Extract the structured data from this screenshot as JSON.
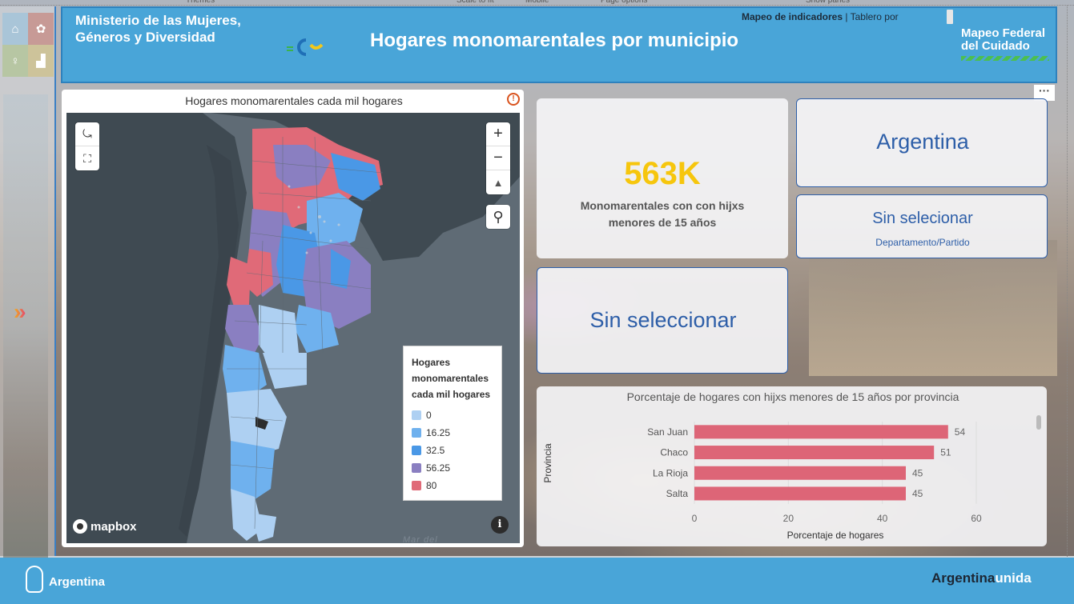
{
  "toolbar_fragments": [
    "Themes",
    "Scale to fit",
    "Mobile",
    "Page options",
    "Show panes"
  ],
  "header": {
    "ministry": "Ministerio de las Mujeres, Géneros y Diversidad",
    "title": "Hogares monomarentales por municipio",
    "link_bold": "Mapeo de indicadores",
    "link_sep": " | ",
    "link_rest": "Tablero por",
    "brand": "Mapeo Federal del Cuidado"
  },
  "map": {
    "title": "Hogares monomarentales cada mil hogares",
    "legend_title": "Hogares monomarentales cada mil hogares",
    "legend": [
      {
        "label": "0",
        "color": "#aed0f2"
      },
      {
        "label": "16.25",
        "color": "#6fb1ee"
      },
      {
        "label": "32.5",
        "color": "#4a98e6"
      },
      {
        "label": "56.25",
        "color": "#8a7fc1"
      },
      {
        "label": "80",
        "color": "#e06a78"
      }
    ],
    "attribution": "mapbox",
    "sea_label": "Mar del",
    "controls": {
      "zoom_in": "+",
      "zoom_out": "−",
      "compass": "▲",
      "search": "⚲",
      "info": "i"
    }
  },
  "kpi": {
    "value": "563K",
    "label": "Monomarentales con con hijxs menores de 15 años",
    "color": "#f6c60d"
  },
  "selection": {
    "country": "Argentina",
    "dept_main": "Sin selecionar",
    "dept_sub": "Departamento/Partido",
    "province": "Sin seleccionar"
  },
  "more_options": "···",
  "chart_data": {
    "type": "bar",
    "orientation": "horizontal",
    "title": "Porcentaje de hogares con hijxs menores de 15 años por provincia",
    "categories": [
      "San Juan",
      "Chaco",
      "La Rioja",
      "Salta"
    ],
    "values": [
      54,
      51,
      45,
      45
    ],
    "ylabel": "Provincia",
    "xlabel": "Porcentaje de hogares",
    "xlim": [
      0,
      60
    ],
    "xticks": [
      0,
      20,
      40,
      60
    ],
    "bar_color": "#dd6577",
    "grid": true
  },
  "footer": {
    "left": "Argentina",
    "right_dark": "Argentina",
    "right_light": "unida"
  }
}
